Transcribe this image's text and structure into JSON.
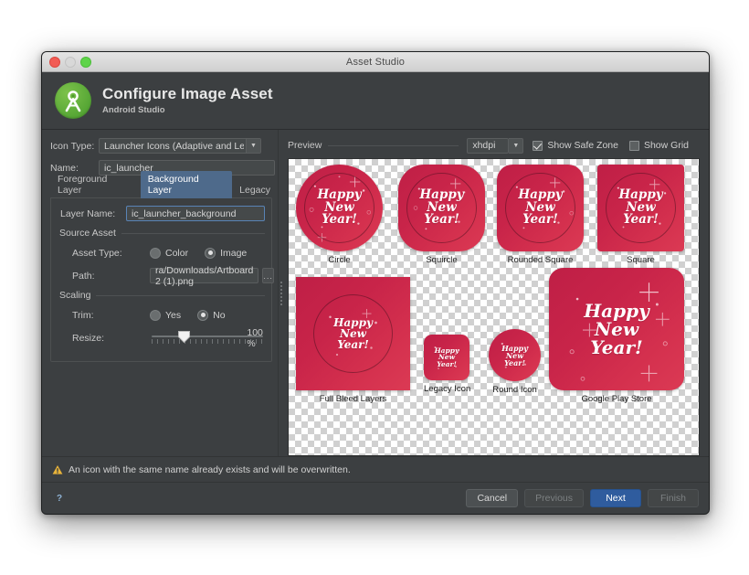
{
  "window": {
    "title": "Asset Studio",
    "traffic_lights": [
      "close",
      "minimize",
      "zoom"
    ]
  },
  "header": {
    "title": "Configure Image Asset",
    "subtitle": "Android Studio",
    "logo_icon": "android-studio-logo"
  },
  "left_panel": {
    "icon_type": {
      "label": "Icon Type:",
      "value": "Launcher Icons (Adaptive and Legacy)"
    },
    "name": {
      "label": "Name:",
      "value": "ic_launcher"
    },
    "tabs": [
      {
        "label": "Foreground Layer",
        "selected": false
      },
      {
        "label": "Background Layer",
        "selected": true
      },
      {
        "label": "Legacy",
        "selected": false
      }
    ],
    "layer_name": {
      "label": "Layer Name:",
      "value": "ic_launcher_background"
    },
    "source_asset": {
      "section_label": "Source Asset",
      "asset_type": {
        "label": "Asset Type:",
        "options": [
          "Color",
          "Image"
        ],
        "selected": "Image"
      },
      "path": {
        "label": "Path:",
        "value": "ra/Downloads/Artboard 2 (1).png",
        "browse_label": "..."
      }
    },
    "scaling": {
      "section_label": "Scaling",
      "trim": {
        "label": "Trim:",
        "options": [
          "Yes",
          "No"
        ],
        "selected": "No"
      },
      "resize": {
        "label": "Resize:",
        "value": "100 %",
        "percent": 100,
        "thumb_position_pct": 24
      }
    }
  },
  "preview": {
    "label": "Preview",
    "density": "xhdpi",
    "show_safe_zone": {
      "label": "Show Safe Zone",
      "checked": true
    },
    "show_grid": {
      "label": "Show Grid",
      "checked": false
    },
    "icon_text_lines": [
      "Happy",
      "New",
      "Year!"
    ],
    "items": [
      {
        "caption": "Circle",
        "shape": "circle",
        "safe_zone": true
      },
      {
        "caption": "Squircle",
        "shape": "squircle",
        "safe_zone": true
      },
      {
        "caption": "Rounded Square",
        "shape": "rsq",
        "safe_zone": true
      },
      {
        "caption": "Square",
        "shape": "sq",
        "safe_zone": true
      },
      {
        "caption": "Full Bleed Layers",
        "shape": "sq2",
        "safe_zone": true
      },
      {
        "caption": "Legacy Icon",
        "shape": "rsq",
        "safe_zone": false
      },
      {
        "caption": "Round Icon",
        "shape": "circle",
        "safe_zone": false
      },
      {
        "caption": "Google Play Store",
        "shape": "rr",
        "safe_zone": false
      }
    ]
  },
  "warning": {
    "icon": "warning-triangle-icon",
    "text": "An icon with the same name already exists and will be overwritten."
  },
  "footer": {
    "help_label": "?",
    "buttons": [
      {
        "label": "Cancel",
        "state": "enabled"
      },
      {
        "label": "Previous",
        "state": "disabled"
      },
      {
        "label": "Next",
        "state": "default"
      },
      {
        "label": "Finish",
        "state": "disabled"
      }
    ]
  },
  "colors": {
    "window_bg": "#3c3f41",
    "accent_blue": "#2f5c9e",
    "tab_selected": "#4e6a8b",
    "icon_red_dark": "#bf1f46",
    "icon_red_light": "#db3a54",
    "warning_yellow": "#e8b33a"
  }
}
